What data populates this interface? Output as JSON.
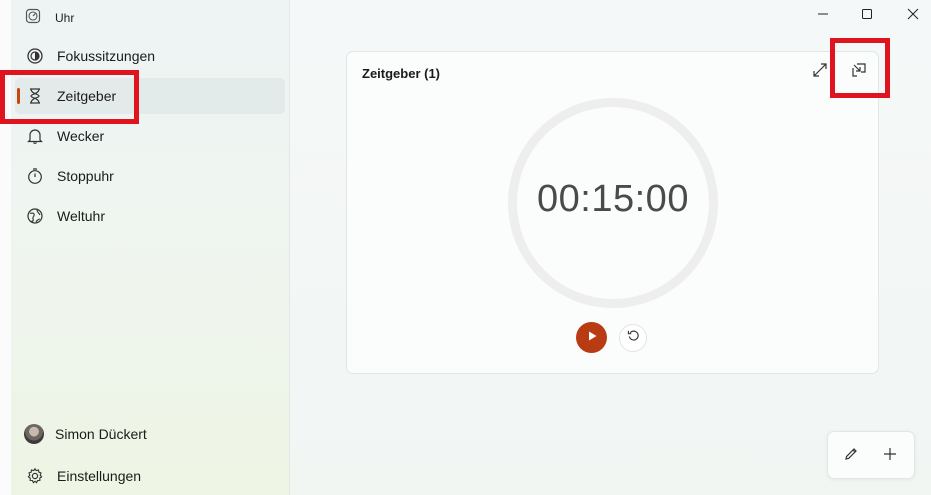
{
  "app": {
    "title": "Uhr"
  },
  "sidebar": {
    "items": [
      {
        "label": "Fokussitzungen",
        "icon": "focus-icon"
      },
      {
        "label": "Zeitgeber",
        "icon": "hourglass-icon",
        "selected": true
      },
      {
        "label": "Wecker",
        "icon": "bell-icon"
      },
      {
        "label": "Stoppuhr",
        "icon": "stopwatch-icon"
      },
      {
        "label": "Weltuhr",
        "icon": "globe-icon"
      }
    ],
    "user": {
      "name": "Simon Dückert"
    },
    "settings": {
      "label": "Einstellungen",
      "icon": "gear-icon"
    }
  },
  "titlebar": {
    "buttons": [
      "minimize-icon",
      "maximize-icon",
      "close-icon"
    ]
  },
  "timer_card": {
    "title": "Zeitgeber (1)",
    "time": "00:15:00",
    "accent_color": "#b93b12"
  },
  "annotation_color": "#e0141e",
  "toolbar": {
    "buttons": [
      "edit-icon",
      "add-icon"
    ]
  }
}
